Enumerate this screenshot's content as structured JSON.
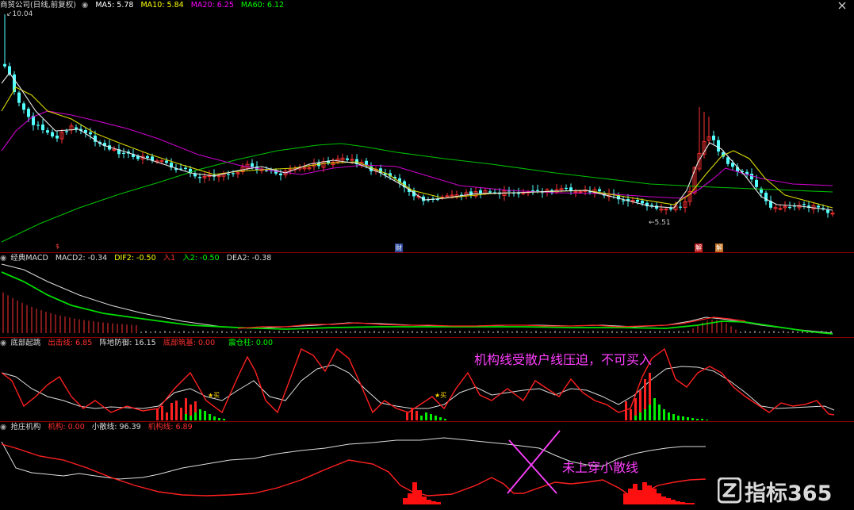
{
  "panel1": {
    "stock_name": "商贸公司",
    "stock_sub": "(日线,前复权)",
    "ma5": {
      "label": "MA5",
      "value": "5.78",
      "color": "#ffffff"
    },
    "ma10": {
      "label": "MA10",
      "value": "5.84",
      "color": "#ffff00"
    },
    "ma20": {
      "label": "MA20",
      "value": "6.25",
      "color": "#ff00ff"
    },
    "ma60": {
      "label": "MA60",
      "value": "6.12",
      "color": "#00ff00"
    },
    "high_label": "10.04",
    "low_label": "5.51",
    "marker_s": "$",
    "marker_cai": "财",
    "marker_jie": "解",
    "marker_jie2": "解"
  },
  "panel2": {
    "title": "经典MACD",
    "macd": "MACD2: -0.34",
    "dif": "DIF2: -0.50",
    "buy": "入1",
    "buy2": "入2: -0.50",
    "dea": "DEA2: -0.38"
  },
  "panel3": {
    "title": "底部起跳",
    "l1": "出击线: 6.85",
    "l2": "阵地防御: 16.15",
    "l3": "底部筑基: 0.00",
    "l4": "震仓柱: 0.00",
    "buy_label": "买",
    "annotation": "机构线受散户线压迫，不可买入"
  },
  "panel4": {
    "title": "抢庄机构",
    "l1": "机构: 0.00",
    "l2": "小散线: 96.39",
    "l3": "机构线: 6.89",
    "annotation": "未上穿小散线"
  },
  "watermark": "指标365",
  "colors": {
    "up": "#ff3232",
    "down": "#54ffff",
    "bg": "#000000",
    "grid": "#8a0000"
  }
}
